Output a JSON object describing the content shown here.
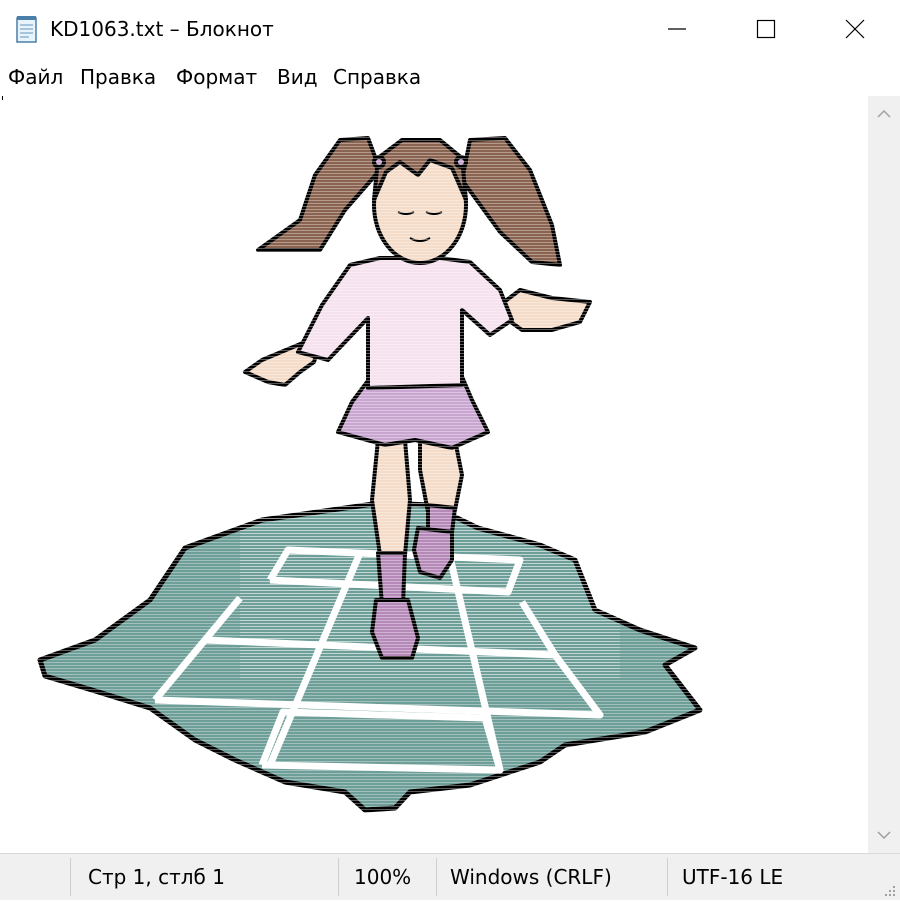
{
  "window": {
    "title": "KD1063.txt – Блокнот",
    "controls": [
      "minimize-icon",
      "maximize-icon",
      "close-icon"
    ]
  },
  "menu": {
    "items": [
      "Файл",
      "Правка",
      "Формат",
      "Вид",
      "Справка"
    ]
  },
  "status": {
    "position": "Стр 1, стлб 1",
    "zoom": "100%",
    "line_ending": "Windows (CRLF)",
    "encoding": "UTF-16 LE"
  },
  "colors": {
    "hair": "#8a6450",
    "shirt": "#f6e1ee",
    "skirt": "#c9a6cf",
    "socks": "#b58ab9",
    "skin": "#f5dcc8",
    "puddle": "#6e9e98",
    "chalk": "#ffffff",
    "outline": "#000000",
    "chrome": "#f0f0f0"
  }
}
